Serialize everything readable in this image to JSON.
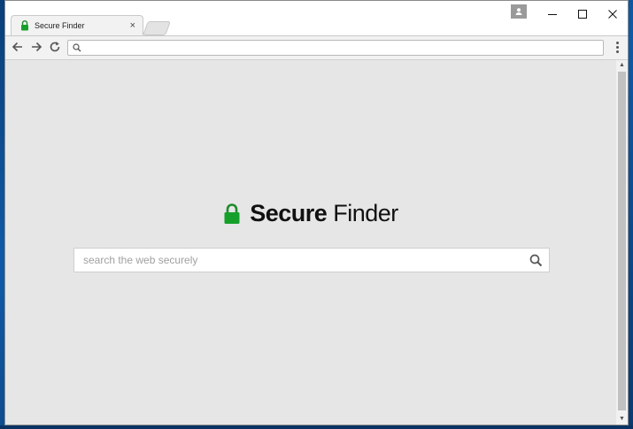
{
  "browser": {
    "tab": {
      "title": "Secure Finder",
      "close_label": "×"
    },
    "window_controls": {
      "minimize": "—",
      "maximize": "☐",
      "close": "✕"
    },
    "nav": {
      "back": "←",
      "forward": "→",
      "reload": "↻"
    },
    "omnibox": {
      "value": "",
      "placeholder": ""
    }
  },
  "page": {
    "logo": {
      "bold": "Secure",
      "normal": "Finder",
      "lock_color": "#16a02b"
    },
    "search": {
      "placeholder": "search the web securely",
      "value": ""
    }
  },
  "icons": {
    "tab_favicon": "lock-icon",
    "profile": "person-icon",
    "search": "magnifier-icon",
    "menu": "three-dots-icon"
  }
}
